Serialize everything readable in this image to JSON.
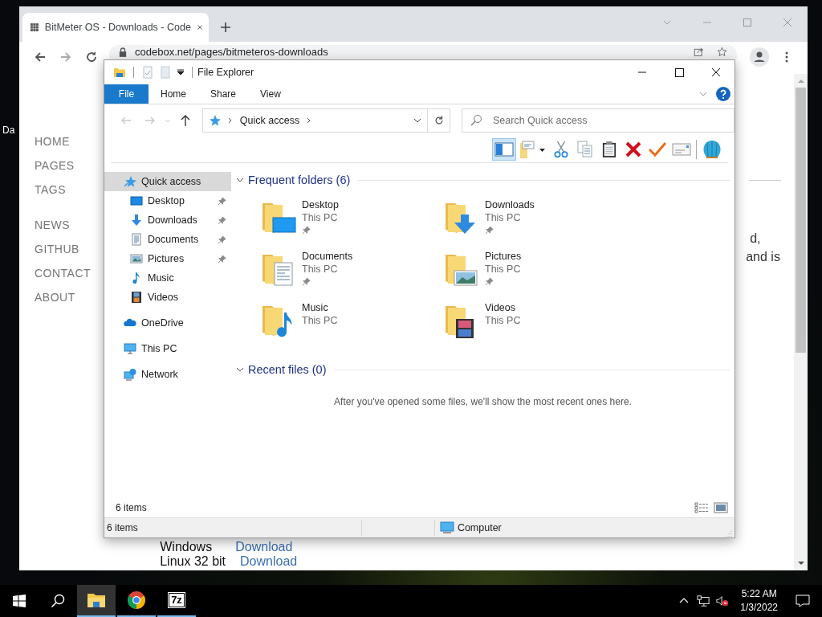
{
  "desktop": {
    "icon_label": "Da"
  },
  "browser": {
    "tabs": [
      {
        "title": "BitMeter OS - Downloads - Code",
        "selected": true
      }
    ],
    "address": "codebox.net/pages/bitmeteros-downloads",
    "nav_groups": [
      [
        "HOME",
        "PAGES",
        "TAGS"
      ],
      [
        "NEWS",
        "GITHUB",
        "CONTACT",
        "ABOUT"
      ]
    ],
    "text_fragments": [
      "d,",
      "and is"
    ],
    "downloads": [
      {
        "platform": "Windows",
        "link": "Download"
      },
      {
        "platform": "Linux 32 bit",
        "link": "Download"
      }
    ]
  },
  "explorer": {
    "title": "File Explorer",
    "ribbon_tabs": [
      {
        "label": "File",
        "selected": true
      },
      {
        "label": "Home",
        "selected": false
      },
      {
        "label": "Share",
        "selected": false
      },
      {
        "label": "View",
        "selected": false
      }
    ],
    "breadcrumb": "Quick access",
    "search": {
      "placeholder": "Search Quick access"
    },
    "toolbar": [
      {
        "kind": "pane",
        "selected": true
      },
      {
        "kind": "folder",
        "selected": false
      },
      {
        "kind": "cut",
        "selected": false
      },
      {
        "kind": "copy",
        "selected": false
      },
      {
        "kind": "paste",
        "selected": false
      },
      {
        "kind": "delete",
        "selected": false
      },
      {
        "kind": "check",
        "selected": false
      },
      {
        "kind": "card",
        "selected": false
      },
      {
        "kind": "shell",
        "selected": false
      }
    ],
    "nav": [
      {
        "label": "Quick access",
        "kind": "star",
        "selected": true,
        "children": [
          {
            "label": "Desktop",
            "kind": "desktop",
            "selected": false,
            "pinned": true
          },
          {
            "label": "Downloads",
            "kind": "download",
            "selected": false,
            "pinned": true
          },
          {
            "label": "Documents",
            "kind": "documents",
            "selected": false,
            "pinned": true
          },
          {
            "label": "Pictures",
            "kind": "pictures",
            "selected": false,
            "pinned": true
          },
          {
            "label": "Music",
            "kind": "music",
            "selected": false,
            "pinned": false
          },
          {
            "label": "Videos",
            "kind": "videos",
            "selected": false,
            "pinned": false
          }
        ]
      },
      {
        "label": "OneDrive",
        "kind": "cloud",
        "selected": false
      },
      {
        "label": "This PC",
        "kind": "pc",
        "selected": false
      },
      {
        "label": "Network",
        "kind": "network",
        "selected": false
      }
    ],
    "sections": [
      {
        "kind": "folders",
        "title": "Frequent folders (6)",
        "expanded": true,
        "folders": [
          {
            "name": "Desktop",
            "location": "This PC",
            "kind": "desktop",
            "pinned": true
          },
          {
            "name": "Downloads",
            "location": "This PC",
            "kind": "download",
            "pinned": true
          },
          {
            "name": "Documents",
            "location": "This PC",
            "kind": "documents",
            "pinned": true
          },
          {
            "name": "Pictures",
            "location": "This PC",
            "kind": "pictures",
            "pinned": true
          },
          {
            "name": "Music",
            "location": "This PC",
            "kind": "music",
            "pinned": false
          },
          {
            "name": "Videos",
            "location": "This PC",
            "kind": "videos",
            "pinned": false
          }
        ]
      },
      {
        "kind": "message",
        "title": "Recent files (0)",
        "expanded": true,
        "message": "After you've opened some files, we'll show the most recent ones here."
      }
    ],
    "footer_count": "6 items",
    "status": {
      "count": "6 items",
      "location": "Computer"
    }
  },
  "taskbar": {
    "apps": [
      {
        "kind": "explorer",
        "selected": true
      },
      {
        "kind": "chrome",
        "selected": false
      },
      {
        "kind": "archiver",
        "label": "7z",
        "selected": false
      }
    ],
    "clock": {
      "time": "5:22 AM",
      "date": "1/3/2022"
    }
  }
}
